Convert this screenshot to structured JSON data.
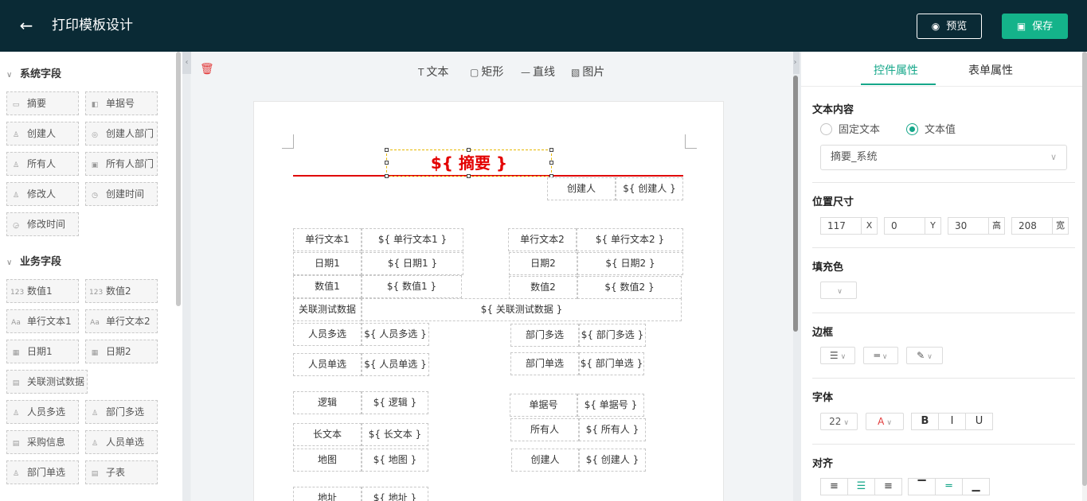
{
  "header": {
    "back_icon": "arrow-left-icon",
    "title": "打印模板设计",
    "preview_label": "预览",
    "save_label": "保存"
  },
  "left": {
    "system_section": "系统字段",
    "business_section": "业务字段",
    "system_fields": [
      "摘要",
      "单据号",
      "创建人",
      "创建人部门",
      "所有人",
      "所有人部门",
      "修改人",
      "创建时间",
      "修改时间"
    ],
    "business_fields": [
      "数值1",
      "数值2",
      "单行文本1",
      "单行文本2",
      "日期1",
      "日期2",
      "关联测试数据",
      "人员多选",
      "部门多选",
      "采购信息",
      "人员单选",
      "部门单选",
      "子表"
    ]
  },
  "toolbar": {
    "text": "文本",
    "rect": "矩形",
    "line": "直线",
    "image": "图片"
  },
  "canvas": {
    "heading": "${ 摘要 }",
    "creator_label": "创建人",
    "creator_value": "${ 创建人 }",
    "left_rows": [
      [
        "单行文本1",
        "${ 单行文本1 }"
      ],
      [
        "日期1",
        "${ 日期1 }"
      ],
      [
        "数值1",
        "${ 数值1 }"
      ],
      [
        "关联测试数据",
        "${ 关联测试数据 }"
      ],
      [
        "人员多选",
        "${ 人员多选 }"
      ],
      [
        "人员单选",
        "${ 人员单选 }"
      ],
      [
        "逻辑",
        "${ 逻辑 }"
      ],
      [
        "长文本",
        "${ 长文本 }"
      ],
      [
        "地图",
        "${ 地图 }"
      ],
      [
        "地址",
        "${ 地址 }"
      ]
    ],
    "right_rows": [
      [
        "单行文本2",
        "${ 单行文本2 }"
      ],
      [
        "日期2",
        "${ 日期2 }"
      ],
      [
        "数值2",
        "${ 数值2 }"
      ],
      [
        "部门多选",
        "${ 部门多选 }"
      ],
      [
        "部门单选",
        "${ 部门单选 }"
      ],
      [
        "单据号",
        "${ 单据号 }"
      ],
      [
        "所有人",
        "${ 所有人 }"
      ],
      [
        "创建人",
        "${ 创建人 }"
      ]
    ]
  },
  "props": {
    "tab_control": "控件属性",
    "tab_form": "表单属性",
    "text_content": "文本内容",
    "radio_fixed": "固定文本",
    "radio_value": "文本值",
    "select_value": "摘要_系统",
    "position_size": "位置尺寸",
    "x": "117",
    "x_unit": "X",
    "y": "0",
    "y_unit": "Y",
    "h": "30",
    "h_unit": "高",
    "w": "208",
    "w_unit": "宽",
    "fill": "填充色",
    "border": "边框",
    "font": "字体",
    "font_size": "22",
    "font_color_letter": "A",
    "bold": "B",
    "italic": "I",
    "underline": "U",
    "align": "对齐",
    "accent": "#16a78a",
    "header_bg": "#0a2a35",
    "heading_color": "#e30000"
  }
}
